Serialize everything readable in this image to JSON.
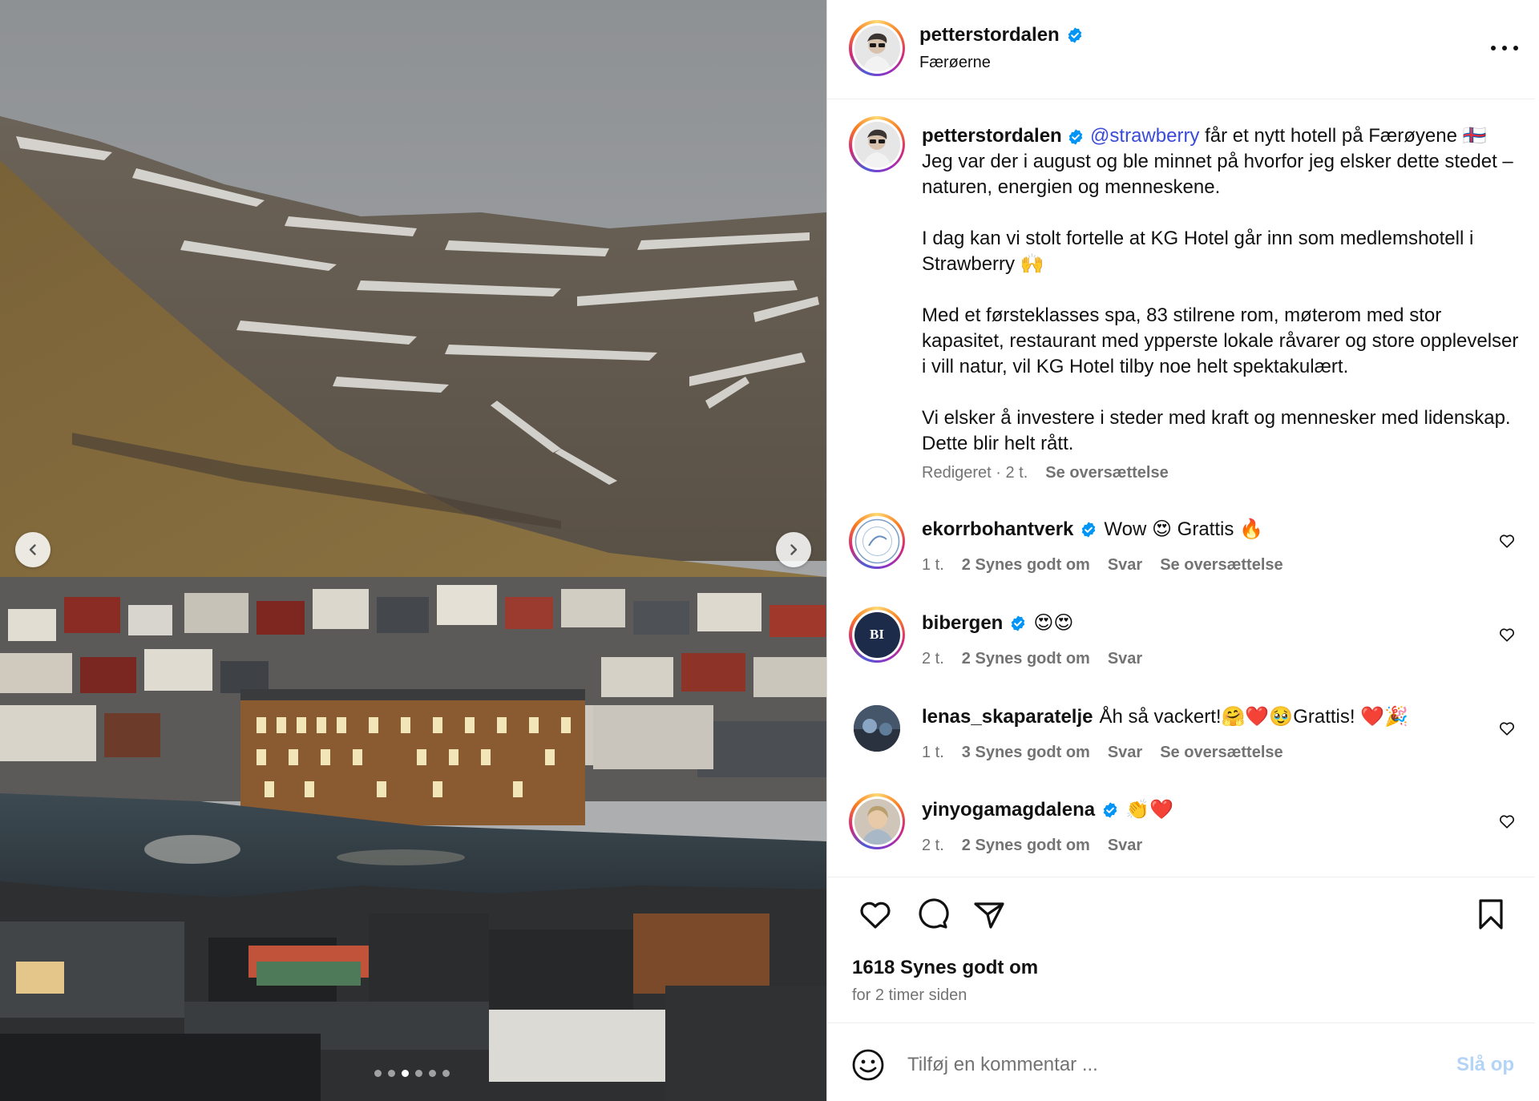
{
  "post": {
    "username": "petterstordalen",
    "location": "Færøerne",
    "more_icon": "more-horizontal-icon"
  },
  "caption": {
    "username": "petterstordalen",
    "mention": "@strawberry",
    "line1_rest": " får et nytt hotell på Færøyene",
    "line2": "🇫🇴 Jeg var der i august og ble minnet på hvorfor jeg elsker dette stedet – naturen, energien og menneskene.",
    "para2": "I dag kan vi stolt fortelle at KG Hotel går inn som medlemshotell i Strawberry 🙌",
    "para3": "Med et førsteklasses spa, 83 stilrene rom, møterom med stor kapasitet, restaurant med ypperste lokale råvarer og store opplevelser i vill natur, vil KG Hotel tilby noe helt spektakulært.",
    "para4": "Vi elsker å investere i steder med kraft og mennesker med lidenskap. Dette blir helt rått.",
    "edited": "Redigeret · 2 t.",
    "translate": "Se oversættelse"
  },
  "comments": [
    {
      "username": "ekorrbohantverk",
      "verified": true,
      "text": "Wow 😍 Grattis 🔥",
      "time": "1 t.",
      "likes": "2 Synes godt om",
      "reply": "Svar",
      "translate": "Se oversættelse"
    },
    {
      "username": "bibergen",
      "verified": true,
      "text": "😍😍",
      "time": "2 t.",
      "likes": "2 Synes godt om",
      "reply": "Svar",
      "avatar_text": "BI"
    },
    {
      "username": "lenas_skaparatelje",
      "verified": false,
      "text": "Åh så vackert!🤗❤️🥹Grattis! ❤️🎉",
      "time": "1 t.",
      "likes": "3 Synes godt om",
      "reply": "Svar",
      "translate": "Se oversættelse"
    },
    {
      "username": "yinyogamagdalena",
      "verified": true,
      "text": "👏❤️",
      "time": "2 t.",
      "likes": "2 Synes godt om",
      "reply": "Svar"
    }
  ],
  "actions": {
    "likes": "1618 Synes godt om",
    "time": "for 2 timer siden"
  },
  "comment_box": {
    "placeholder": "Tilføj en kommentar ...",
    "post_label": "Slå op"
  },
  "carousel": {
    "slides": 6,
    "active": 3
  },
  "colors": {
    "verified": "#0095f6",
    "mention": "#3a4bd8",
    "muted": "#737373",
    "post_disabled": "#b3d3f7"
  }
}
